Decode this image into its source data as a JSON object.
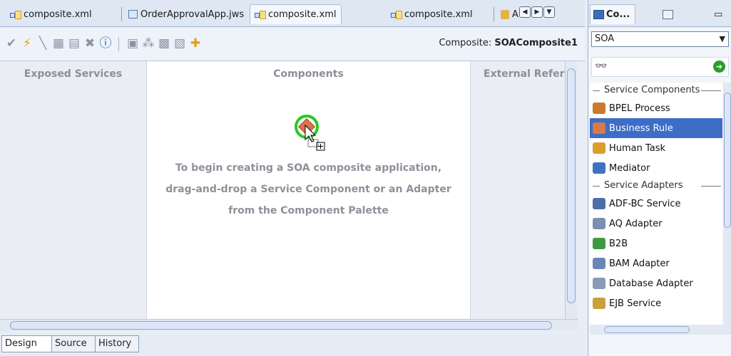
{
  "tabs": [
    {
      "label": "composite.xml",
      "icon": "composite-icon",
      "active": false
    },
    {
      "label": "OrderApprovalApp.jws",
      "icon": "jws-icon",
      "active": false
    },
    {
      "label": "composite.xml",
      "icon": "composite-icon",
      "active": true
    },
    {
      "label": "composite.xml",
      "icon": "composite-icon",
      "active": false
    },
    {
      "label": "Au",
      "icon": "bpel-icon",
      "active": false
    }
  ],
  "toolbar": {
    "composite_prefix": "Composite:",
    "composite_name": "SOAComposite1"
  },
  "canvas": {
    "lanes": {
      "exposed": "Exposed Services",
      "components": "Components",
      "external": "External Refere"
    },
    "hint": [
      "To begin creating a SOA composite application,",
      "drag-and-drop a Service Component or an Adapter",
      "from the Component Palette"
    ]
  },
  "bottom_tabs": [
    "Design",
    "Source",
    "History"
  ],
  "palette": {
    "tabs": [
      {
        "label": "Co...",
        "active": true
      },
      {
        "label": "",
        "active": false
      }
    ],
    "category": "SOA",
    "groups": [
      {
        "label": "Service Components",
        "items": [
          {
            "label": "BPEL Process",
            "icon": "bpel-process-icon",
            "color": "#c97a2a",
            "selected": false
          },
          {
            "label": "Business Rule",
            "icon": "business-rule-icon",
            "color": "#d97a4a",
            "selected": true
          },
          {
            "label": "Human Task",
            "icon": "human-task-icon",
            "color": "#d9a030",
            "selected": false
          },
          {
            "label": "Mediator",
            "icon": "mediator-icon",
            "color": "#3f72c2",
            "selected": false
          }
        ]
      },
      {
        "label": "Service Adapters",
        "items": [
          {
            "label": "ADF-BC Service",
            "icon": "adf-bc-icon",
            "color": "#4b6fa8",
            "selected": false
          },
          {
            "label": "AQ Adapter",
            "icon": "aq-adapter-icon",
            "color": "#7b8fb0",
            "selected": false
          },
          {
            "label": "B2B",
            "icon": "b2b-icon",
            "color": "#3f9a3f",
            "selected": false
          },
          {
            "label": "BAM Adapter",
            "icon": "bam-adapter-icon",
            "color": "#6a86b8",
            "selected": false
          },
          {
            "label": "Database Adapter",
            "icon": "database-adapter-icon",
            "color": "#8a9ab8",
            "selected": false
          },
          {
            "label": "EJB Service",
            "icon": "ejb-service-icon",
            "color": "#c9a03a",
            "selected": false
          }
        ]
      }
    ]
  },
  "colors": {
    "selection": "#3d6dc7",
    "lane_bg": "#eaeef4",
    "hint_text": "#8d9199"
  }
}
